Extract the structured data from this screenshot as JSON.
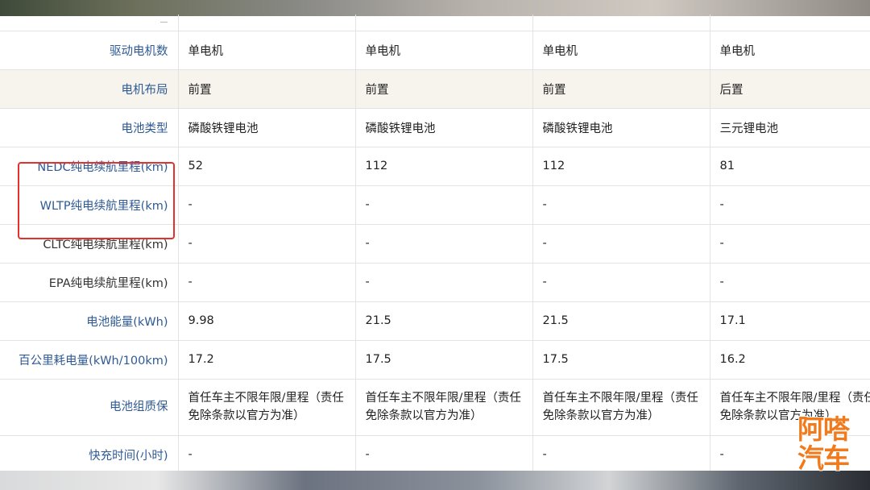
{
  "table": {
    "cut_row": [
      "—",
      "",
      "",
      "",
      ""
    ],
    "rows": [
      {
        "label": "驱动电机数",
        "values": [
          "单电机",
          "单电机",
          "单电机",
          "单电机"
        ],
        "label_style": "blue"
      },
      {
        "label": "电机布局",
        "values": [
          "前置",
          "前置",
          "前置",
          "后置"
        ],
        "label_style": "blue"
      },
      {
        "label": "电池类型",
        "values": [
          "磷酸铁锂电池",
          "磷酸铁锂电池",
          "磷酸铁锂电池",
          "三元锂电池"
        ],
        "label_style": "blue"
      },
      {
        "label": "NEDC纯电续航里程(km)",
        "values": [
          "52",
          "112",
          "112",
          "81"
        ],
        "label_style": "blue"
      },
      {
        "label": "WLTP纯电续航里程(km)",
        "values": [
          "-",
          "-",
          "-",
          "-"
        ],
        "label_style": "blue"
      },
      {
        "label": "CLTC纯电续航里程(km)",
        "values": [
          "-",
          "-",
          "-",
          "-"
        ],
        "label_style": "plain"
      },
      {
        "label": "EPA纯电续航里程(km)",
        "values": [
          "-",
          "-",
          "-",
          "-"
        ],
        "label_style": "plain"
      },
      {
        "label": "电池能量(kWh)",
        "values": [
          "9.98",
          "21.5",
          "21.5",
          "17.1"
        ],
        "label_style": "blue"
      },
      {
        "label": "百公里耗电量(kWh/100km)",
        "values": [
          "17.2",
          "17.5",
          "17.5",
          "16.2"
        ],
        "label_style": "blue"
      },
      {
        "label": "电池组质保",
        "values": [
          "首任车主不限年限/里程（责任免除条款以官方为准）",
          "首任车主不限年限/里程（责任免除条款以官方为准）",
          "首任车主不限年限/里程（责任免除条款以官方为准）",
          "首任车主不限年限/里程（责任免除条款以官方为准）"
        ],
        "label_style": "blue"
      },
      {
        "label": "快充时间(小时)",
        "values": [
          "-",
          "-",
          "-",
          "-"
        ],
        "label_style": "blue"
      }
    ]
  },
  "highlight": {
    "color": "#e3322b"
  },
  "logo": {
    "line1": "阿嗒",
    "line2": "汽车",
    "color": "#f07a1c"
  }
}
